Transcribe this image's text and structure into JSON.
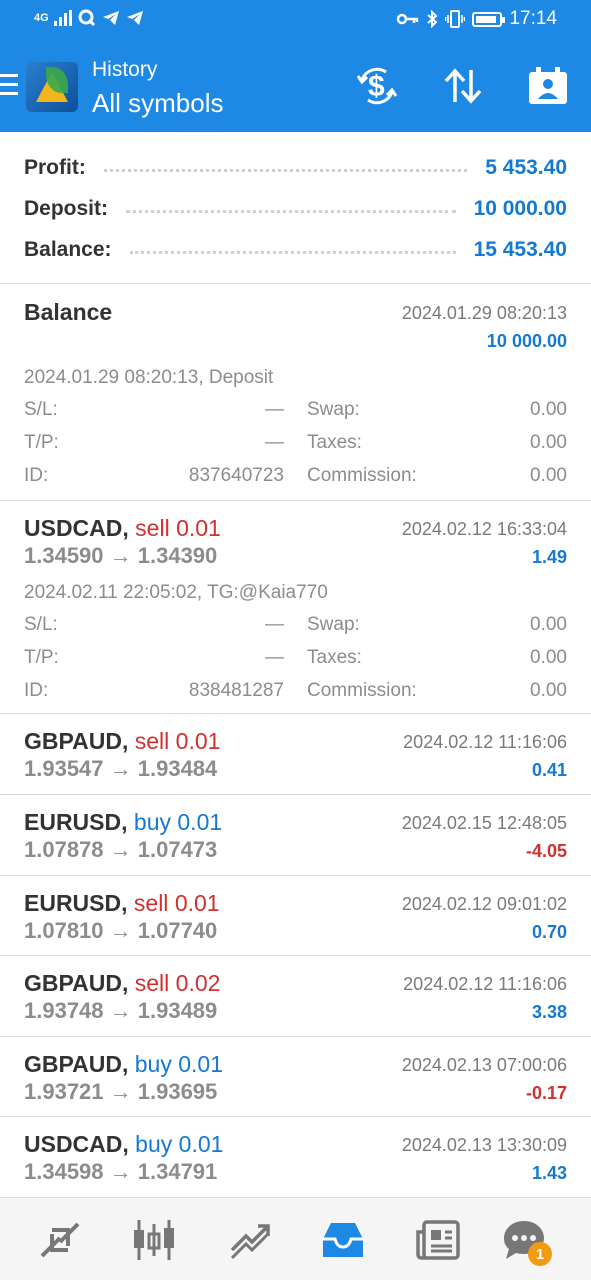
{
  "status_bar": {
    "network": "4G",
    "time": "17:14",
    "icons": [
      "signal-icon",
      "q-app-icon",
      "telegram-icon",
      "telegram-icon",
      "key-icon",
      "bluetooth-icon",
      "vibrate-icon",
      "battery-icon"
    ]
  },
  "toolbar": {
    "subtitle": "History",
    "title": "All symbols",
    "icons": [
      "menu-icon",
      "metatrader-logo",
      "currency-exchange-icon",
      "sort-icon",
      "calendar-icon"
    ],
    "accent_color": "#1e88e5"
  },
  "summary": {
    "profit_label": "Profit:",
    "profit_value": "5 453.40",
    "deposit_label": "Deposit:",
    "deposit_value": "10 000.00",
    "balance_label": "Balance:",
    "balance_value": "15 453.40"
  },
  "balance_entry": {
    "title": "Balance",
    "time": "2024.01.29 08:20:13",
    "amount": "10 000.00",
    "comment": "2024.01.29 08:20:13, Deposit",
    "sl_label": "S/L:",
    "sl_value": "—",
    "swap_label": "Swap:",
    "swap_value": "0.00",
    "tp_label": "T/P:",
    "tp_value": "—",
    "taxes_label": "Taxes:",
    "taxes_value": "0.00",
    "id_label": "ID:",
    "id_value": "837640723",
    "commission_label": "Commission:",
    "commission_value": "0.00"
  },
  "deals": [
    {
      "symbol": "USDCAD,",
      "side": "sell",
      "volume": "0.01",
      "prices": "1.34590 → 1.34390",
      "time": "2024.02.12 16:33:04",
      "profit": "1.49",
      "comment": "2024.02.11 22:05:02, TG:@Kaia770",
      "sl_label": "S/L:",
      "sl_value": "—",
      "swap_label": "Swap:",
      "swap_value": "0.00",
      "tp_label": "T/P:",
      "tp_value": "—",
      "taxes_label": "Taxes:",
      "taxes_value": "0.00",
      "id_label": "ID:",
      "id_value": "838481287",
      "commission_label": "Commission:",
      "commission_value": "0.00"
    },
    {
      "symbol": "GBPAUD,",
      "side": "sell",
      "volume": "0.01",
      "prices": "1.93547 → 1.93484",
      "time": "2024.02.12 11:16:06",
      "profit": "0.41"
    },
    {
      "symbol": "EURUSD,",
      "side": "buy",
      "volume": "0.01",
      "prices": "1.07878 → 1.07473",
      "time": "2024.02.15 12:48:05",
      "profit": "-4.05"
    },
    {
      "symbol": "EURUSD,",
      "side": "sell",
      "volume": "0.01",
      "prices": "1.07810 → 1.07740",
      "time": "2024.02.12 09:01:02",
      "profit": "0.70"
    },
    {
      "symbol": "GBPAUD,",
      "side": "sell",
      "volume": "0.02",
      "prices": "1.93748 → 1.93489",
      "time": "2024.02.12 11:16:06",
      "profit": "3.38"
    },
    {
      "symbol": "GBPAUD,",
      "side": "buy",
      "volume": "0.01",
      "prices": "1.93721 → 1.93695",
      "time": "2024.02.13 07:00:06",
      "profit": "-0.17"
    },
    {
      "symbol": "USDCAD,",
      "side": "buy",
      "volume": "0.01",
      "prices": "1.34598 → 1.34791",
      "time": "2024.02.13 13:30:09",
      "profit": "1.43"
    }
  ],
  "bottom_nav": {
    "items": [
      "quotes-icon",
      "chart-icon",
      "trade-icon",
      "history-icon",
      "news-icon",
      "chat-icon"
    ],
    "active": "history-icon",
    "chat_badge": "1"
  }
}
